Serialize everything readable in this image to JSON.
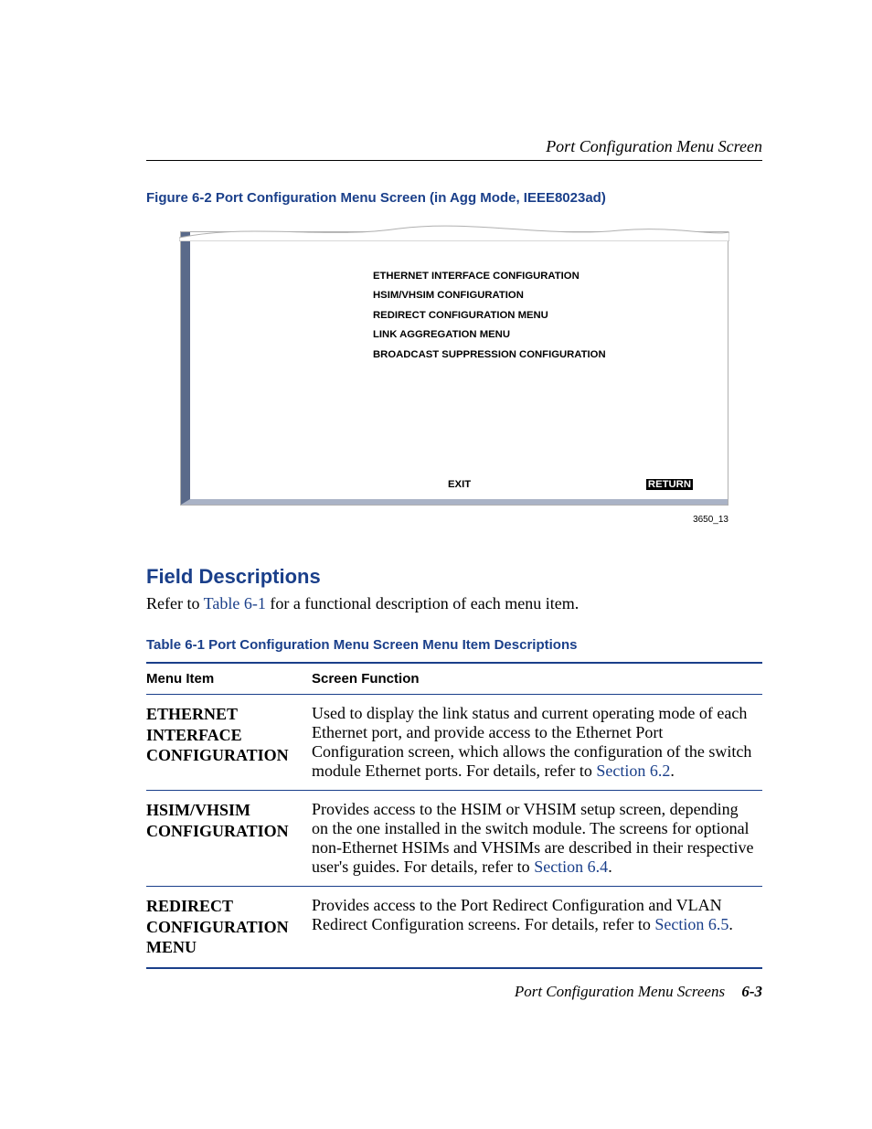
{
  "header": {
    "running": "Port Configuration Menu Screen"
  },
  "figure": {
    "caption": "Figure 6-2   Port Configuration Menu Screen (in Agg Mode, IEEE8023ad)",
    "menu_items": [
      "ETHERNET INTERFACE CONFIGURATION",
      "HSIM/VHSIM  CONFIGURATION",
      "REDIRECT CONFIGURATION MENU",
      "LINK AGGREGATION MENU",
      "BROADCAST SUPPRESSION CONFIGURATION"
    ],
    "exit_label": "EXIT",
    "return_label": "RETURN",
    "ref": "3650_13"
  },
  "section": {
    "title": "Field Descriptions",
    "intro_pre": "Refer to ",
    "intro_link": "Table 6-1",
    "intro_post": " for a functional description of each menu item."
  },
  "table": {
    "caption": "Table 6-1   Port Configuration Menu Screen Menu Item Descriptions",
    "headers": {
      "col1": "Menu Item",
      "col2": "Screen Function"
    },
    "rows": [
      {
        "menu": "ETHERNET INTERFACE CONFIGURATION",
        "desc_pre": "Used to display the link status and current operating mode of each Ethernet port, and provide access to the Ethernet Port Configuration screen, which allows the configuration of the switch module Ethernet ports. For details, refer to ",
        "desc_link": "Section 6.2",
        "desc_post": "."
      },
      {
        "menu": "HSIM/VHSIM CONFIGURATION",
        "desc_pre": "Provides access to the HSIM or VHSIM setup screen, depending on the one installed in the switch module. The screens for optional non-Ethernet HSIMs and VHSIMs are described in their respective user's guides. For details, refer to ",
        "desc_link": "Section 6.4",
        "desc_post": "."
      },
      {
        "menu": "REDIRECT CONFIGURATION MENU",
        "desc_pre": "Provides access to the Port Redirect Configuration and VLAN Redirect Configuration screens. For details, refer to ",
        "desc_link": "Section 6.5",
        "desc_post": "."
      }
    ]
  },
  "footer": {
    "text": "Port Configuration Menu Screens",
    "page": "6-3"
  }
}
